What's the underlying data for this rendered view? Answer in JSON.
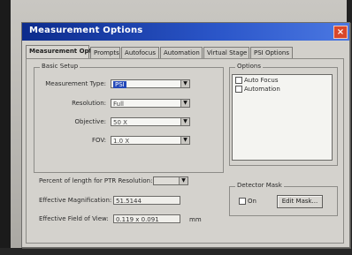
{
  "window": {
    "title": "Measurement Options",
    "close_glyph": "×"
  },
  "tabs": [
    {
      "label": "Measurement Options",
      "active": true
    },
    {
      "label": "Prompts",
      "active": false
    },
    {
      "label": "Autofocus",
      "active": false
    },
    {
      "label": "Automation",
      "active": false
    },
    {
      "label": "Virtual Stage",
      "active": false
    },
    {
      "label": "PSI Options",
      "active": false
    }
  ],
  "basic_setup": {
    "title": "Basic Setup",
    "measurement_type": {
      "label": "Measurement Type:",
      "value": "PSI"
    },
    "resolution": {
      "label": "Resolution:",
      "value": "Full"
    },
    "objective": {
      "label": "Objective:",
      "value": "50 X"
    },
    "fov": {
      "label": "FOV:",
      "value": "1.0 X"
    },
    "ptr_resolution": {
      "label": "Percent of length for PTR Resolution:",
      "value": ""
    },
    "effective_magnification": {
      "label": "Effective Magnification:",
      "value": "51.5144"
    },
    "effective_fov": {
      "label": "Effective Field of View:",
      "value": "0.119 x 0.091",
      "unit": "mm"
    }
  },
  "options": {
    "title": "Options",
    "items": [
      {
        "label": "Auto Focus",
        "checked": false
      },
      {
        "label": "Automation",
        "checked": false
      }
    ]
  },
  "detector_mask": {
    "title": "Detector Mask",
    "on_label": "On",
    "on_checked": false,
    "edit_button": "Edit Mask..."
  },
  "colors": {
    "titlebar_start": "#0c2b8c",
    "titlebar_end": "#4b78e2",
    "dialog_face": "#d2d0cb",
    "selection": "#2449b8",
    "close_red": "#d9472a"
  },
  "icons": {
    "close": "close-icon",
    "dropdown": "chevron-down-icon"
  }
}
